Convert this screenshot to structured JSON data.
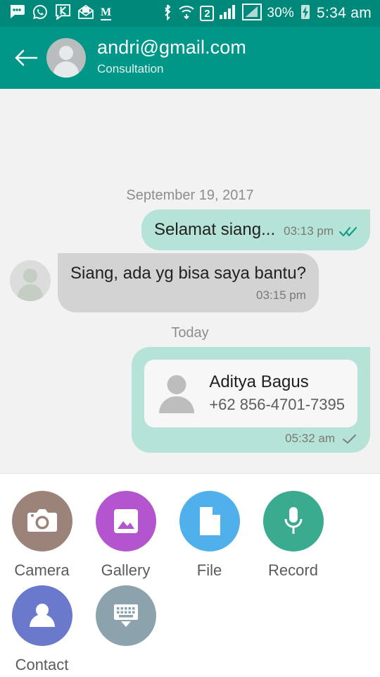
{
  "statusbar": {
    "left_icons": [
      {
        "name": "messages-icon",
        "glyph": "chat-dots"
      },
      {
        "name": "whatsapp-icon",
        "glyph": "whatsapp"
      },
      {
        "name": "kakao-k-icon",
        "glyph": "k-bubble"
      },
      {
        "name": "email-open-icon",
        "glyph": "open-envelope"
      },
      {
        "name": "medium-icon",
        "glyph": "M"
      }
    ],
    "right_icons": [
      {
        "name": "bluetooth-icon",
        "glyph": "bluetooth"
      },
      {
        "name": "wifi-icon",
        "glyph": "wifi"
      },
      {
        "name": "dual-sim-icon",
        "glyph": "2"
      },
      {
        "name": "signal-sim1-icon",
        "glyph": "signal"
      },
      {
        "name": "signal-sim2-icon",
        "glyph": "signal-boxed"
      }
    ],
    "battery_percent": "30%",
    "battery_charging_icon": "battery-charging-icon",
    "clock": "5:34 am"
  },
  "appbar": {
    "back_icon": "back-arrow-icon",
    "avatar_icon": "contact-avatar",
    "title": "andri@gmail.com",
    "subtitle": "Consultation",
    "background_color": "#009688"
  },
  "chat": {
    "background_color": "#f2f2f2",
    "dividers": {
      "first": "September 19, 2017",
      "second": "Today"
    },
    "messages": [
      {
        "id": "msg-1",
        "direction": "outgoing",
        "type": "text",
        "text": "Selamat siang...",
        "time": "03:13 pm",
        "status_icon": "double-check-icon",
        "status_color": "#0f9b87",
        "bubble_color": "#b6e3d7"
      },
      {
        "id": "msg-2",
        "direction": "incoming",
        "type": "text",
        "text": "Siang, ada yg bisa saya bantu?",
        "time": "03:15 pm",
        "avatar_icon": "contact-avatar",
        "bubble_color": "#d3d3d3"
      },
      {
        "id": "msg-3",
        "direction": "outgoing",
        "type": "contact-card",
        "contact_name": "Aditya Bagus",
        "contact_phone": "+62 856-4701-7395",
        "contact_avatar_icon": "person-icon",
        "time": "05:32 am",
        "status_icon": "single-check-icon",
        "status_color": "#7d7d7d",
        "bubble_color": "#b6e3d7"
      }
    ]
  },
  "attachments": {
    "row1": [
      {
        "name": "attachment-camera",
        "label": "Camera",
        "icon": "camera-icon",
        "color": "#9c8379"
      },
      {
        "name": "attachment-gallery",
        "label": "Gallery",
        "icon": "image-icon",
        "color": "#b455d0"
      },
      {
        "name": "attachment-file",
        "label": "File",
        "icon": "file-icon",
        "color": "#4fb0ec"
      },
      {
        "name": "attachment-record",
        "label": "Record",
        "icon": "microphone-icon",
        "color": "#3aab8e"
      }
    ],
    "row2": [
      {
        "name": "attachment-contact",
        "label": "Contact",
        "icon": "person-icon",
        "color": "#6b79cc"
      },
      {
        "name": "hide-keyboard-button",
        "label": "",
        "icon": "keyboard-hide-icon",
        "color": "#8ca3ad"
      }
    ]
  }
}
